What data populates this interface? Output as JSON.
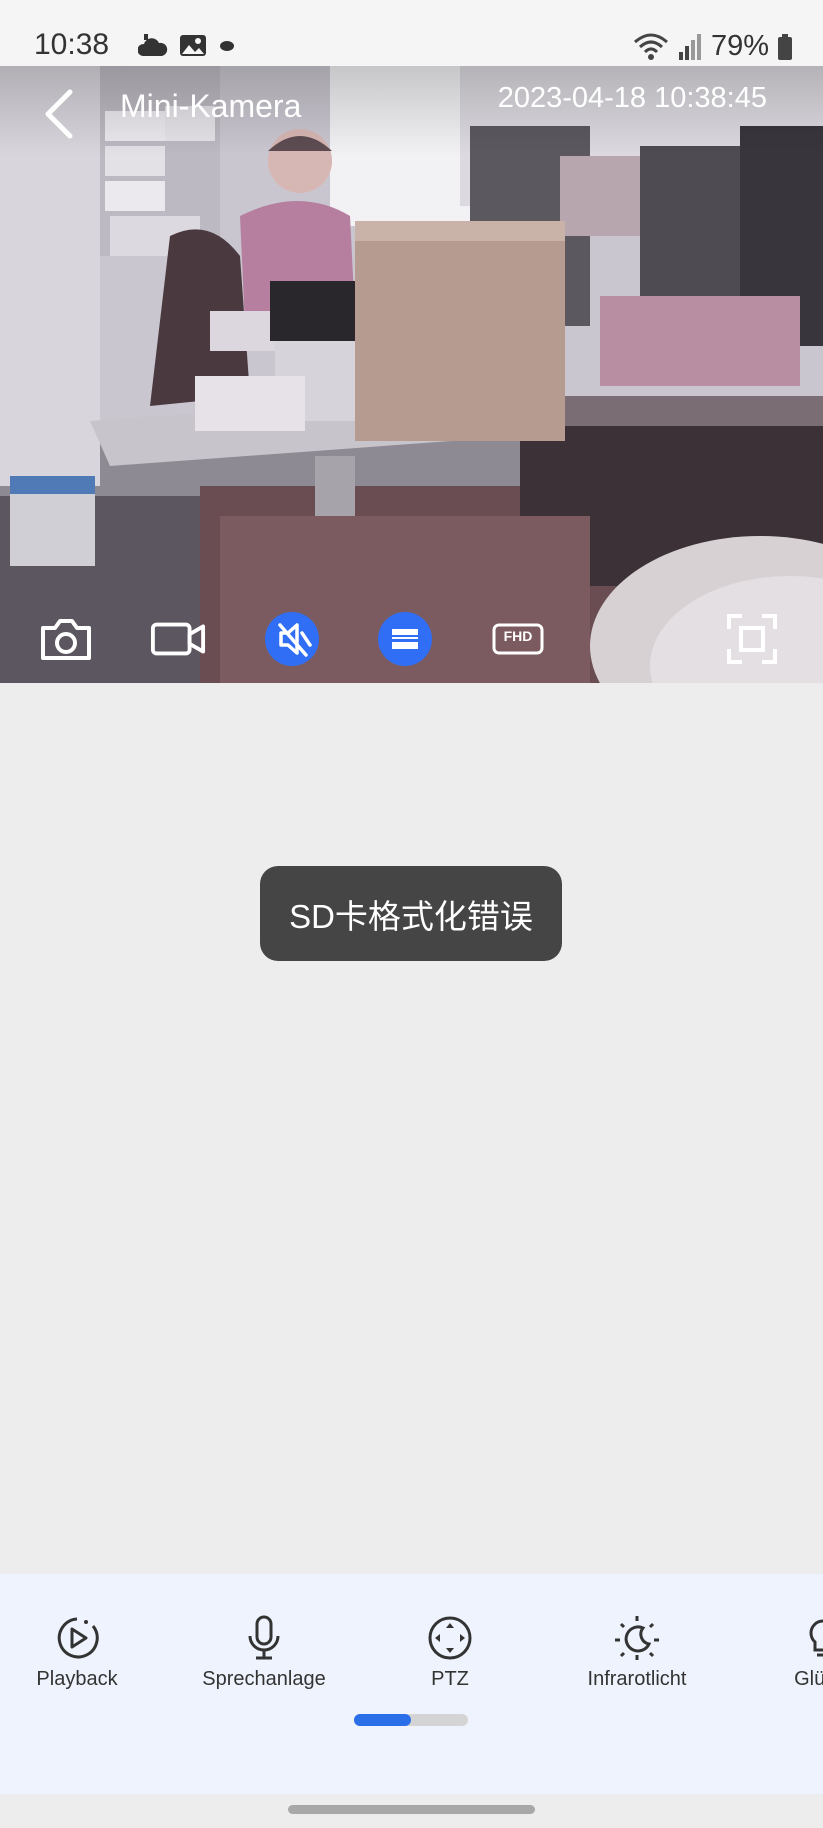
{
  "status_bar": {
    "time": "10:38",
    "battery_percent": "79%",
    "icons": [
      "weather-icon",
      "gallery-icon",
      "app-icon",
      "wifi-icon",
      "signal-icon",
      "battery-icon"
    ]
  },
  "camera": {
    "title": "Mini-Kamera",
    "timestamp": "2023-04-18 10:38:45",
    "toolbar": {
      "items": [
        "camera-snapshot-icon",
        "video-record-icon",
        "speaker-muted-icon",
        "screen-split-icon",
        "fhd-quality-icon",
        "fullscreen-icon"
      ],
      "quality_label": "FHD",
      "active_color": "#2f6ef5"
    }
  },
  "toast": {
    "message": "SD卡格式化错误"
  },
  "controls": {
    "items": [
      {
        "icon": "playback-icon",
        "label": "Playback"
      },
      {
        "icon": "microphone-icon",
        "label": "Sprechanlage"
      },
      {
        "icon": "ptz-icon",
        "label": "PTZ"
      },
      {
        "icon": "night-mode-icon",
        "label": "Infrarotlicht"
      },
      {
        "icon": "light-bulb-icon",
        "label": "Glühla"
      }
    ],
    "scroll_position_fraction": 0.5
  },
  "colors": {
    "accent": "#2b6fe8",
    "panel_bg": "#eef3fd",
    "page_bg": "#ededed"
  }
}
